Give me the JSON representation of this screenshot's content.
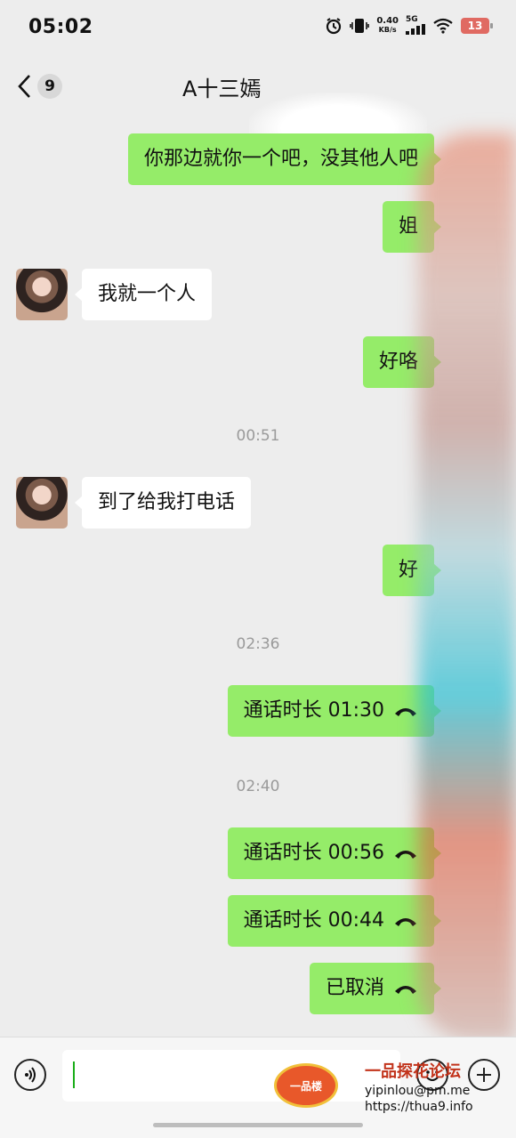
{
  "status_bar": {
    "time": "05:02",
    "net_speed_value": "0.40",
    "net_speed_unit": "KB/s",
    "signal_label": "5G",
    "battery": "13"
  },
  "header": {
    "unread_count": "9",
    "title": "A十三嫣"
  },
  "messages": [
    {
      "from": "me",
      "text": "你那边就你一个吧，没其他人吧"
    },
    {
      "from": "me",
      "text": "姐"
    },
    {
      "from": "them",
      "text": "我就一个人"
    },
    {
      "from": "me",
      "text": "好咯"
    },
    {
      "type": "timestamp",
      "text": "00:51"
    },
    {
      "from": "them",
      "text": "到了给我打电话"
    },
    {
      "from": "me",
      "text": "好"
    },
    {
      "type": "timestamp",
      "text": "02:36"
    },
    {
      "from": "me",
      "text": "通话时长 01:30"
    },
    {
      "type": "timestamp",
      "text": "02:40"
    },
    {
      "from": "me",
      "text": "通话时长 00:56"
    },
    {
      "from": "me",
      "text": "通话时长 00:44"
    },
    {
      "from": "me",
      "text": "已取消"
    }
  ],
  "input": {
    "value": ""
  },
  "watermark": {
    "logo_text": "一品楼",
    "site_name": "一品探花论坛",
    "email": "yipinlou@pm.me",
    "url": "https://thua9.info"
  },
  "colors": {
    "my_bubble": "#95ec69",
    "their_bubble": "#ffffff",
    "background": "#ededed"
  }
}
